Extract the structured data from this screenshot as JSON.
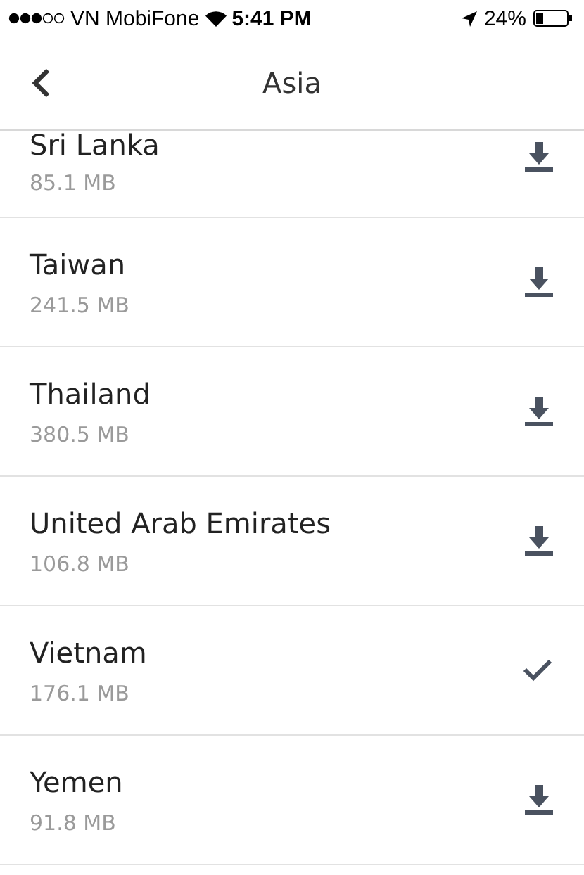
{
  "status_bar": {
    "carrier": "VN MobiFone",
    "time": "5:41 PM",
    "battery": "24%"
  },
  "nav": {
    "title": "Asia"
  },
  "regions": [
    {
      "name": "Sri Lanka",
      "size": "85.1 MB",
      "downloaded": false
    },
    {
      "name": "Taiwan",
      "size": "241.5 MB",
      "downloaded": false
    },
    {
      "name": "Thailand",
      "size": "380.5 MB",
      "downloaded": false
    },
    {
      "name": "United Arab Emirates",
      "size": "106.8 MB",
      "downloaded": false
    },
    {
      "name": "Vietnam",
      "size": "176.1 MB",
      "downloaded": true
    },
    {
      "name": "Yemen",
      "size": "91.8 MB",
      "downloaded": false
    }
  ]
}
